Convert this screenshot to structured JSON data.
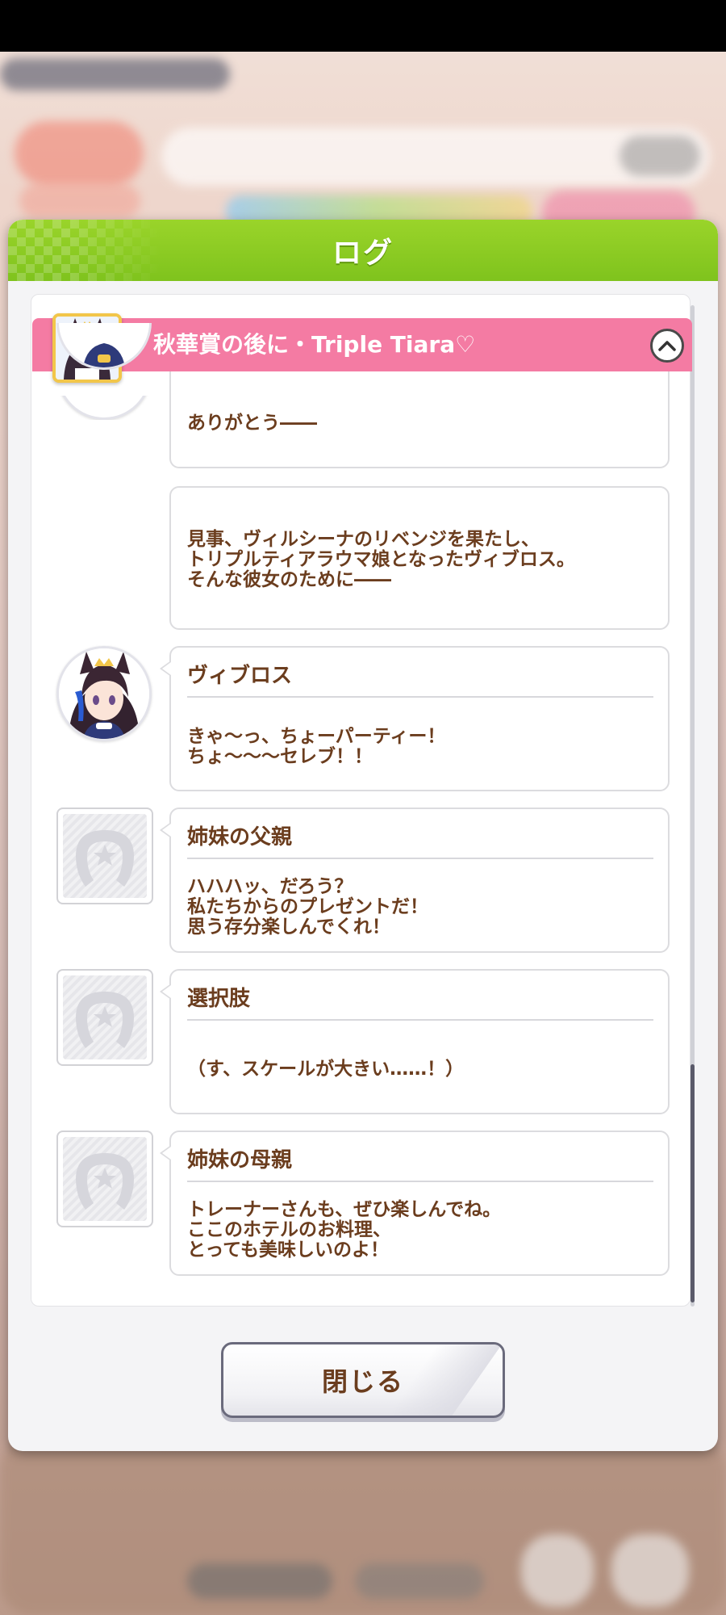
{
  "modal": {
    "title": "ログ",
    "close_label": "閉じる",
    "header_color": "#8ccd22",
    "banner_color": "#f47ba3"
  },
  "story": {
    "title": "秋華賞の後に・Triple Tiara♡"
  },
  "entries": [
    {
      "speaker": "",
      "avatar": "character",
      "lines": [
        "ありがとう――"
      ]
    },
    {
      "speaker": "",
      "avatar": "none",
      "lines": [
        "見事、ヴィルシーナのリベンジを果たし、",
        "トリプルティアラウマ娘となったヴィブロス。",
        "そんな彼女のために――"
      ]
    },
    {
      "speaker": "ヴィブロス",
      "avatar": "character",
      "lines": [
        "きゃ～っ、ちょーパーティー！",
        "ちょ～～～セレブ！！"
      ]
    },
    {
      "speaker": "姉妹の父親",
      "avatar": "generic",
      "lines": [
        "ハハハッ、だろう？",
        "私たちからのプレゼントだ！",
        "思う存分楽しんでくれ！"
      ]
    },
    {
      "speaker": "選択肢",
      "avatar": "generic",
      "lines": [
        "（す、スケールが大きい……！）"
      ]
    },
    {
      "speaker": "姉妹の母親",
      "avatar": "generic",
      "lines": [
        "トレーナーさんも、ぜひ楽しんでね。",
        "ここのホテルのお料理、",
        "とっても美味しいのよ！"
      ]
    }
  ]
}
